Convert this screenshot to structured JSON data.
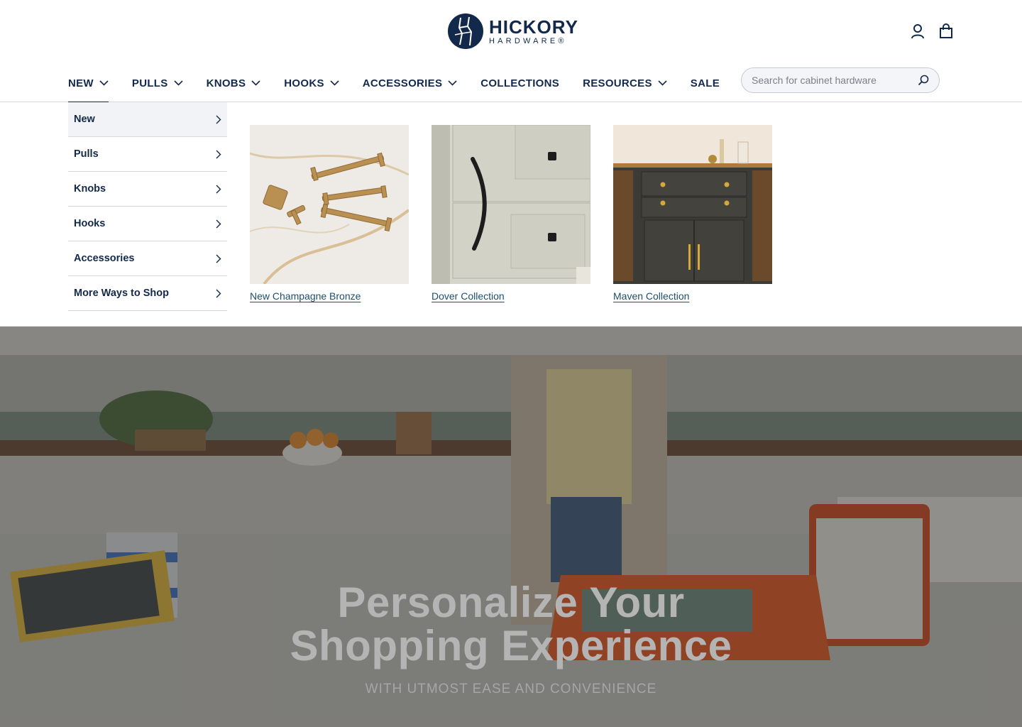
{
  "brand": {
    "name": "HICKORY",
    "sub": "HARDWARE®"
  },
  "header_icons": [
    "account-icon",
    "cart-icon"
  ],
  "nav": {
    "items": [
      {
        "label": "NEW",
        "has_dropdown": true,
        "active": true
      },
      {
        "label": "PULLS",
        "has_dropdown": true
      },
      {
        "label": "KNOBS",
        "has_dropdown": true
      },
      {
        "label": "HOOKS",
        "has_dropdown": true
      },
      {
        "label": "ACCESSORIES",
        "has_dropdown": true
      },
      {
        "label": "COLLECTIONS",
        "has_dropdown": false
      },
      {
        "label": "RESOURCES",
        "has_dropdown": true
      },
      {
        "label": "SALE",
        "has_dropdown": false
      }
    ]
  },
  "search": {
    "placeholder": "Search for cabinet hardware"
  },
  "mega_menu": {
    "items": [
      "New",
      "Pulls",
      "Knobs",
      "Hooks",
      "Accessories",
      "More Ways to Shop"
    ],
    "promos": [
      {
        "label": "New Champagne Bronze"
      },
      {
        "label": "Dover Collection"
      },
      {
        "label": "Maven Collection"
      }
    ]
  },
  "hero": {
    "title_line1": "Personalize Your",
    "title_line2": "Shopping Experience",
    "subtitle": "WITH UTMOST EASE AND CONVENIENCE"
  },
  "colors": {
    "brand_navy": "#13294b",
    "link_blue": "#1c4f6e"
  }
}
